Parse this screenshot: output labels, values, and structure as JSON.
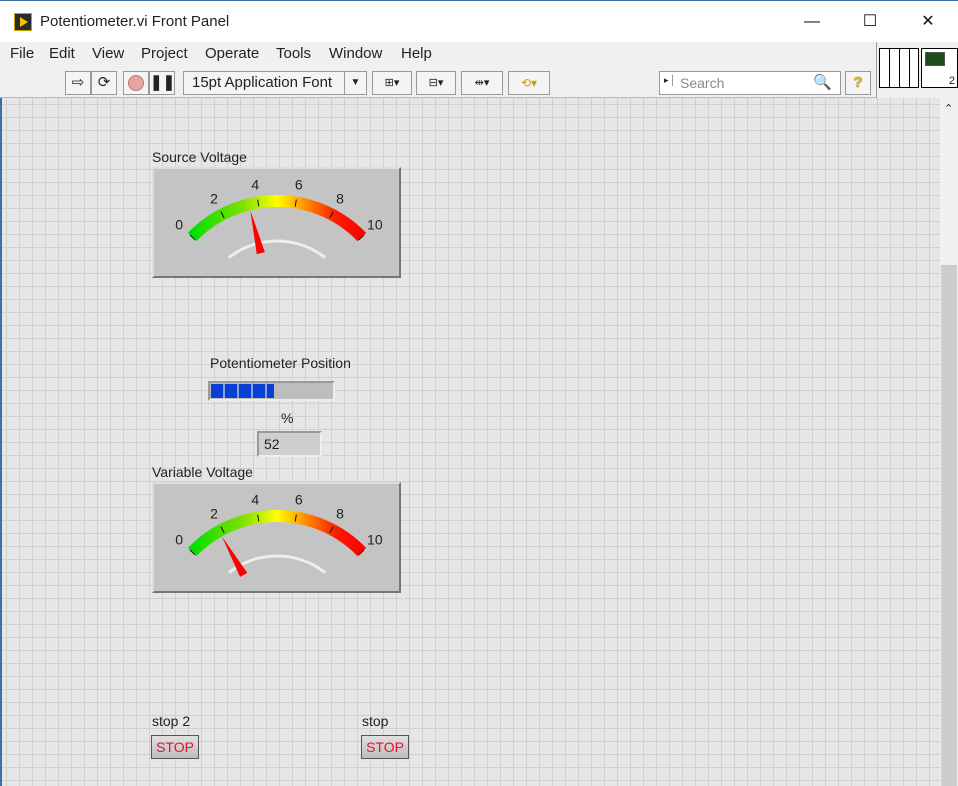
{
  "window": {
    "title": "Potentiometer.vi Front Panel",
    "minimize": "—",
    "maximize": "☐",
    "close": "✕"
  },
  "menu": [
    "File",
    "Edit",
    "View",
    "Project",
    "Operate",
    "Tools",
    "Window",
    "Help"
  ],
  "toolbar": {
    "font": "15pt Application Font",
    "search_placeholder": "Search",
    "help": "?",
    "connector_count": "2"
  },
  "source_gauge": {
    "label": "Source Voltage",
    "ticks": [
      "0",
      "2",
      "4",
      "6",
      "8",
      "10"
    ],
    "min": 0,
    "max": 10,
    "value": 3.5
  },
  "position": {
    "label": "Potentiometer  Position",
    "unit": "%",
    "value": "52",
    "fill_percent": 52
  },
  "variable_gauge": {
    "label": "Variable Voltage",
    "ticks": [
      "0",
      "2",
      "4",
      "6",
      "8",
      "10"
    ],
    "min": 0,
    "max": 10,
    "value": 1.8
  },
  "stop2": {
    "label": "stop 2",
    "button": "STOP"
  },
  "stop": {
    "label": "stop",
    "button": "STOP"
  },
  "colors": {
    "needle": "#ff0000",
    "progress": "#0a3fd6",
    "stop_text": "#e8102c"
  }
}
